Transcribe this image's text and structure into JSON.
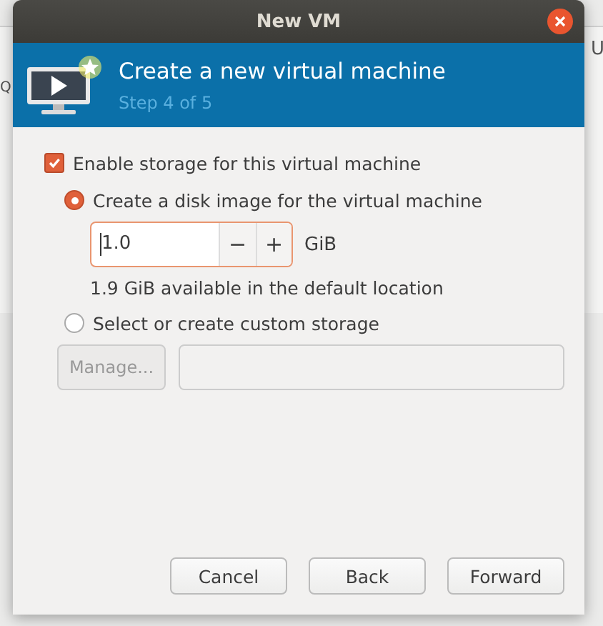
{
  "background": {
    "texts": [
      "Q",
      "U"
    ]
  },
  "window": {
    "title": "New VM"
  },
  "header": {
    "title": "Create a new virtual machine",
    "subtitle": "Step 4 of 5"
  },
  "storage": {
    "label": "Enable storage for this virtual machine",
    "checked": true
  },
  "options": [
    {
      "kind": "disk",
      "label": "Create a disk image for the virtual machine",
      "selected": true
    },
    {
      "kind": "custom",
      "label": "Select or create custom storage",
      "selected": false
    }
  ],
  "disk": {
    "value": "1.0",
    "decrement": "−",
    "increment": "+",
    "unit": "GiB",
    "available": "1.9 GiB available in the default location"
  },
  "custom": {
    "manage": {
      "label": "Manage...",
      "disabled": true
    }
  },
  "buttons": [
    "Cancel",
    "Back",
    "Forward"
  ]
}
